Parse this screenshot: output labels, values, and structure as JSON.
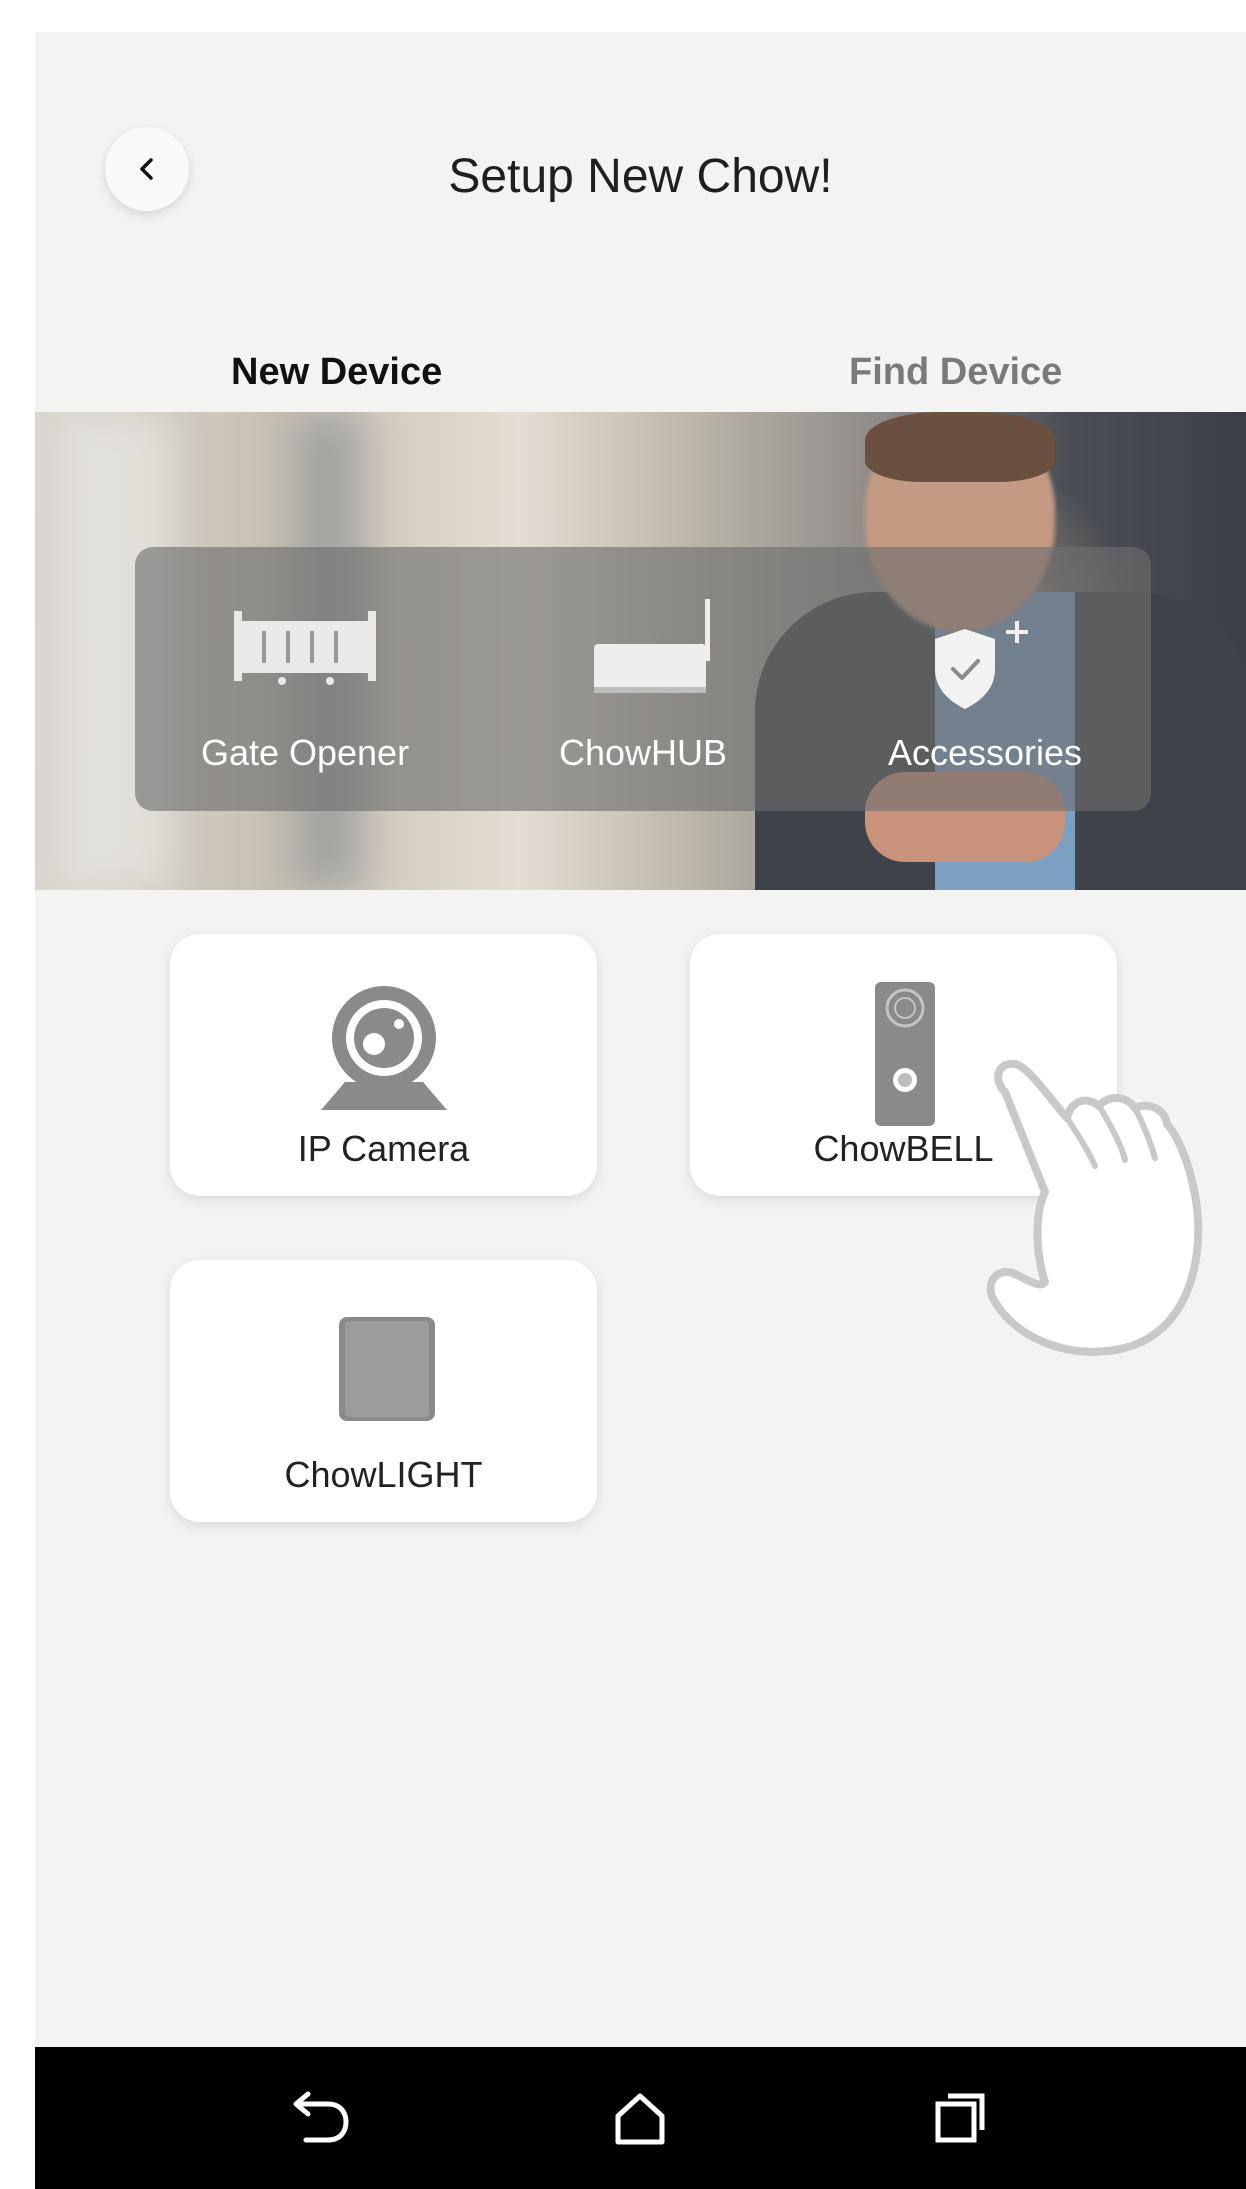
{
  "header": {
    "title": "Setup New Chow!",
    "back_icon": "chevron-left-icon"
  },
  "tabs": [
    {
      "label": "New Device",
      "active": true
    },
    {
      "label": "Find Device",
      "active": false
    }
  ],
  "featured_devices": [
    {
      "label": "Gate Opener",
      "icon": "gate-icon"
    },
    {
      "label": "ChowHUB",
      "icon": "hub-icon"
    },
    {
      "label": "Accessories",
      "icon": "shield-plus-icon"
    }
  ],
  "device_cards": [
    {
      "label": "IP Camera",
      "icon": "webcam-icon"
    },
    {
      "label": "ChowBELL",
      "icon": "doorbell-icon"
    },
    {
      "label": "ChowLIGHT",
      "icon": "light-switch-icon"
    }
  ],
  "colors": {
    "accent": "#f07a2e",
    "background": "#f3f3f2",
    "icon_gray": "#8a8a8a",
    "navbar": "#000000"
  },
  "navbar": {
    "back_icon": "back-arrow-icon",
    "home_icon": "home-icon",
    "recents_icon": "recents-icon"
  }
}
